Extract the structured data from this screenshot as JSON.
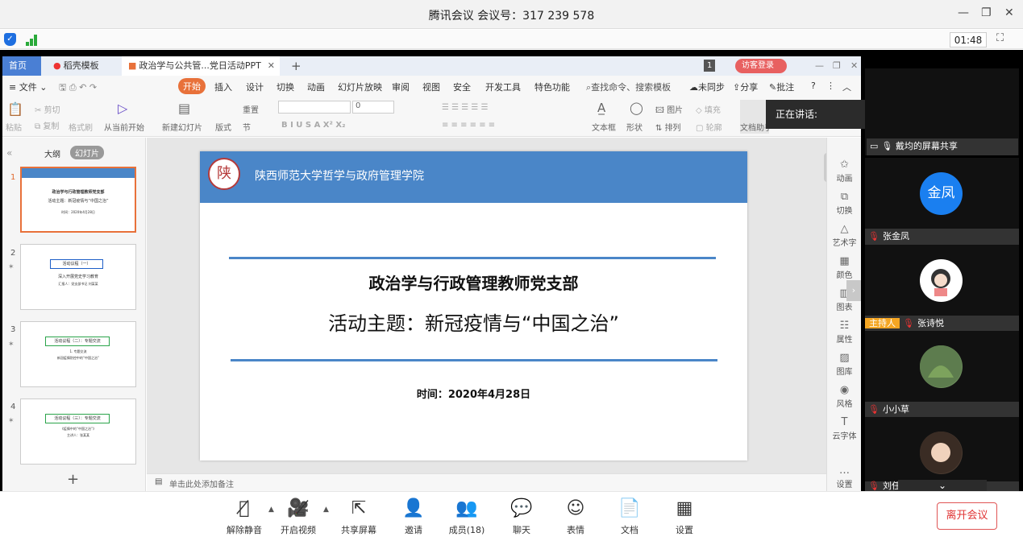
{
  "window": {
    "title": "腾讯会议 会议号：317 239 578",
    "timer": "01:48"
  },
  "wps": {
    "tabs": [
      {
        "label": "首页"
      },
      {
        "label": "稻壳模板"
      },
      {
        "label": "政治学与公共管...党日活动PPT"
      }
    ],
    "page_count": "1",
    "visitor_login": "访客登录",
    "menu": [
      "文件",
      "开始",
      "插入",
      "设计",
      "切换",
      "动画",
      "幻灯片放映",
      "审阅",
      "视图",
      "安全",
      "开发工具",
      "特色功能"
    ],
    "search_placeholder": "查找命令、搜索模板",
    "sync": "未同步",
    "share": "分享",
    "annotate": "批注",
    "ribbon": {
      "paste": "粘贴",
      "cut": "剪切",
      "copy": "复制",
      "format_painter": "格式刷",
      "from_current": "从当前开始",
      "new_slide": "新建幻灯片",
      "layout": "版式",
      "reset": "重置",
      "section": "节",
      "font_size": "0",
      "textbox": "文本框",
      "shape": "形状",
      "picture": "图片",
      "fill": "填充",
      "arrange": "排列",
      "outline": "轮廓",
      "doc_assist": "文档助手"
    },
    "panel_tabs": [
      "大纲",
      "幻灯片"
    ],
    "slides_count": [
      1,
      2,
      3,
      4
    ],
    "notes_placeholder": "单击此处添加备注",
    "right_tools": [
      "动画",
      "切换",
      "艺术字",
      "颜色",
      "图表",
      "属性",
      "图库",
      "风格",
      "云字体",
      "设置"
    ]
  },
  "slide": {
    "org": "陕西师范大学哲学与政府管理学院",
    "seal_char": "陕",
    "title": "政治学与行政管理教师党支部",
    "subtitle": "活动主题：新冠疫情与“中国之治”",
    "date": "时间：2020年4月28日"
  },
  "thumbnails": [
    {
      "line1": "政治学与行政管理教师党支部",
      "line2": "活动主题：新冠疫情与“中国之治”",
      "line3": "时间：2020年4月28日"
    },
    {
      "box": "活动议程（一）",
      "line1": "深入开展党史学习教育",
      "line2": "汇报人：党支部书记 刘某某"
    },
    {
      "box": "活动议程（二）：专题交流",
      "line1": "1. 专题交流",
      "line2": "新冠疫情防控中的“中国之治”"
    },
    {
      "box": "活动议程（三）：专题交流",
      "line1": "《疫情中的“中国之治”》",
      "line2": "主讲人：张某某"
    }
  ],
  "speaking": "正在讲话:",
  "participants": [
    {
      "name": "戴均的屏幕共享",
      "avatar": ""
    },
    {
      "name": "张金凤",
      "avatar": "金凤"
    },
    {
      "name": "张诗悦",
      "host": "主持人"
    },
    {
      "name": "小小草"
    },
    {
      "name": "刘任"
    }
  ],
  "bottom": {
    "buttons": [
      "解除静音",
      "开启视频",
      "共享屏幕",
      "邀请",
      "成员(18)",
      "聊天",
      "表情",
      "文档",
      "设置"
    ],
    "leave": "离开会议"
  },
  "colors": {
    "accent": "#4a86c8",
    "wps_orange": "#e8713a",
    "leave_red": "#e03535",
    "host_tag": "#f5a623"
  }
}
